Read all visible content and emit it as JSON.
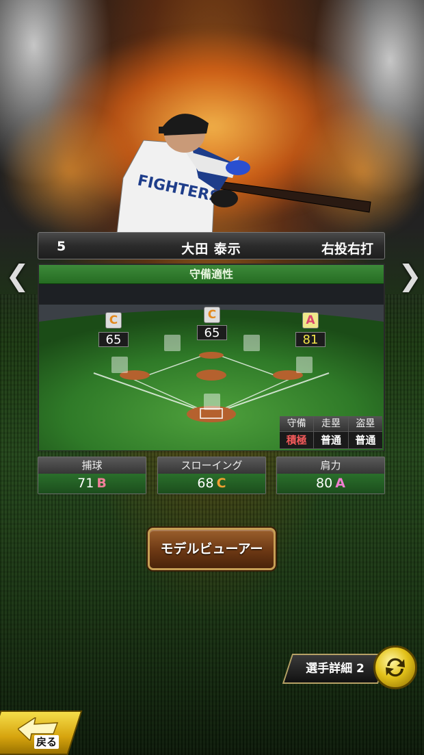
{
  "player": {
    "number": "5",
    "name": "大田 泰示",
    "handedness": "右投右打"
  },
  "defense": {
    "title": "守備適性",
    "positions": [
      {
        "grade": "C",
        "value": "65"
      },
      {
        "grade": "C",
        "value": "65"
      },
      {
        "grade": "A",
        "value": "81"
      }
    ],
    "traits": {
      "headers": [
        "守備",
        "走塁",
        "盗塁"
      ],
      "values": [
        "積極",
        "普通",
        "普通"
      ]
    }
  },
  "stats": [
    {
      "label": "捕球",
      "value": "71",
      "grade": "B"
    },
    {
      "label": "スローイング",
      "value": "68",
      "grade": "C"
    },
    {
      "label": "肩力",
      "value": "80",
      "grade": "A"
    }
  ],
  "buttons": {
    "model_viewer": "モデルビューアー",
    "player_detail": "選手詳細 2",
    "back": "戻る"
  },
  "nav": {
    "prev": "❮",
    "next": "❯"
  },
  "colors": {
    "accent_green": "#256c22",
    "grade_a": "#f07fd0",
    "grade_b": "#f07f9a",
    "grade_c": "#f2a032",
    "gold": "#e3c21a"
  }
}
